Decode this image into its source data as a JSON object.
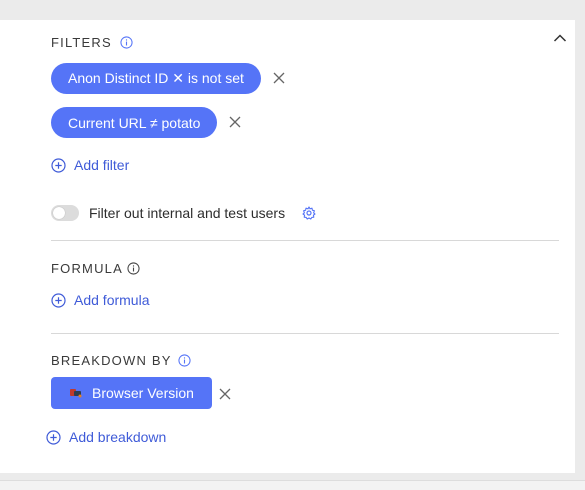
{
  "filters": {
    "title": "FILTERS",
    "items": [
      {
        "label": "Anon Distinct ID ✕ is not set"
      },
      {
        "label": "Current URL ≠ potato"
      }
    ],
    "add_label": "Add filter"
  },
  "internal_filter": {
    "label": "Filter out internal and test users",
    "enabled": false
  },
  "formula": {
    "title": "FORMULA",
    "add_label": "Add formula"
  },
  "breakdown": {
    "title": "BREAKDOWN BY",
    "item_label": "Browser Version",
    "add_label": "Add breakdown"
  },
  "colors": {
    "accent": "#5574f7",
    "link": "#3f5bd8"
  }
}
